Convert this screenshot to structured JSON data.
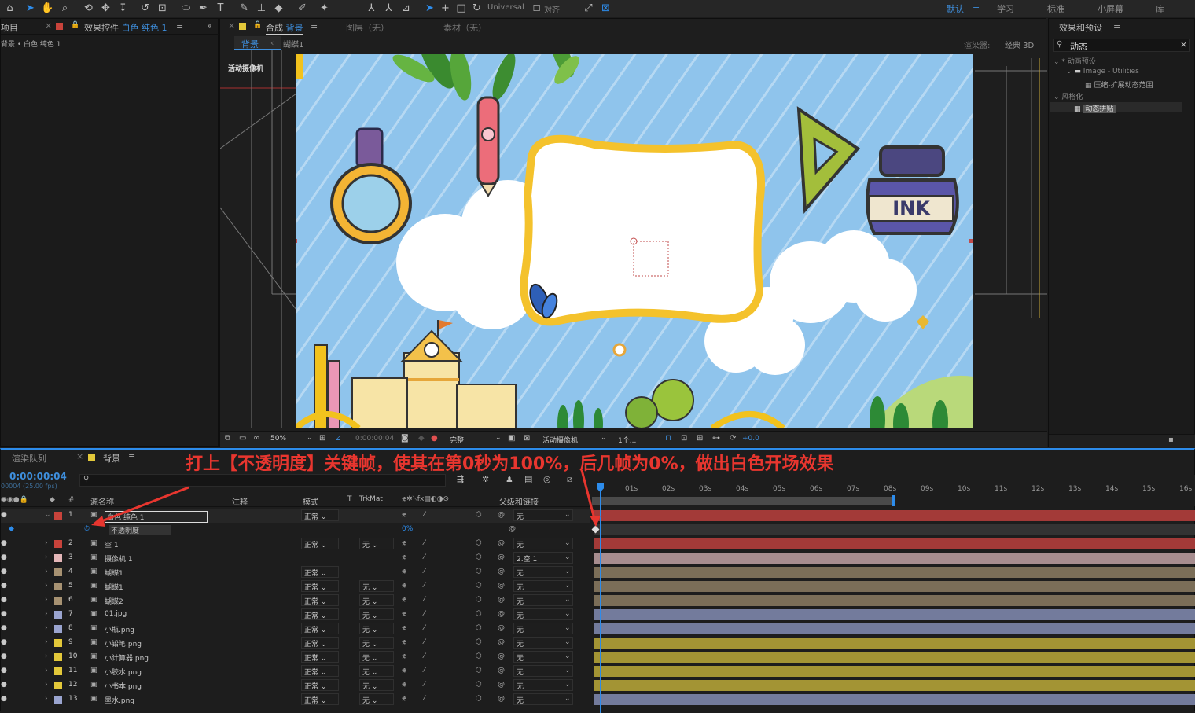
{
  "toolbar": {
    "universal_label": "Universal",
    "align_label": "对齐",
    "workspaces": [
      "默认",
      "学习",
      "标准",
      "小屏幕",
      "库"
    ],
    "active_workspace": "默认"
  },
  "project_panel": {
    "tab_label": "项目",
    "effects_tab_prefix": "效果控件",
    "effects_tab_layer": "白色 纯色 1",
    "breadcrumb": "背景 • 白色 纯色 1"
  },
  "comp_panel": {
    "tab_prefix": "合成",
    "tab_comp": "背景",
    "layer_tab": "图层（无）",
    "footage_tab": "素材（无）",
    "subtab_active": "背景",
    "subtab_next": "蝴蝶1",
    "renderer_label": "渲染器:",
    "renderer_value": "经典 3D",
    "camera_label": "活动摄像机",
    "artboard_text": "INK"
  },
  "viewer_footer": {
    "zoom": "50%",
    "timecode": "0:00:00:04",
    "resolution": "完整",
    "camera_view": "活动摄像机",
    "views": "1个...",
    "exposure": "+0.0"
  },
  "effects_presets": {
    "title": "效果和预设",
    "search_value": "动态",
    "tree": [
      {
        "label": "* 动画预设"
      },
      {
        "label": "Image - Utilities"
      },
      {
        "label": "压缩-扩展动态范围"
      },
      {
        "label": "风格化"
      },
      {
        "label": "动态拼贴"
      }
    ]
  },
  "timeline": {
    "render_queue_tab": "渲染队列",
    "comp_tab": "背景",
    "timecode": "0:00:00:04",
    "fps_label": "00004 (25.00 fps)",
    "search_placeholder": "",
    "headers": {
      "source_name": "源名称",
      "comment": "注释",
      "mode": "模式",
      "t": "T",
      "trkmat": "TrkMat",
      "parent": "父级和链接"
    },
    "opacity_prop": "不透明度",
    "opacity_value": "0%",
    "ruler": [
      "01s",
      "02s",
      "03s",
      "04s",
      "05s",
      "06s",
      "07s",
      "08s",
      "09s",
      "10s",
      "11s",
      "12s",
      "13s",
      "14s",
      "15s",
      "16s"
    ],
    "layers": [
      {
        "num": "1",
        "name": "白色 纯色 1",
        "mode": "正常",
        "trkmat": "",
        "parent": "无",
        "color": "#c8433b",
        "bar": "#a33a38"
      },
      {
        "num": "2",
        "name": "空 1",
        "mode": "正常",
        "trkmat": "无",
        "parent": "无",
        "color": "#c8433b",
        "bar": "#a33a38"
      },
      {
        "num": "3",
        "name": "摄像机 1",
        "mode": "",
        "trkmat": "",
        "parent": "2.空 1",
        "color": "#e5b7b9",
        "bar": "#a78d8f"
      },
      {
        "num": "4",
        "name": "蝴蝶1",
        "mode": "正常",
        "trkmat": "",
        "parent": "无",
        "color": "#a79272",
        "bar": "#7b6e58"
      },
      {
        "num": "5",
        "name": "蝴蝶1",
        "mode": "正常",
        "trkmat": "无",
        "parent": "无",
        "color": "#a79272",
        "bar": "#7b6e58"
      },
      {
        "num": "6",
        "name": "蝴蝶2",
        "mode": "正常",
        "trkmat": "无",
        "parent": "无",
        "color": "#a79272",
        "bar": "#7b6e58"
      },
      {
        "num": "7",
        "name": "01.jpg",
        "mode": "正常",
        "trkmat": "无",
        "parent": "无",
        "color": "#9aa4cf",
        "bar": "#737b9c"
      },
      {
        "num": "8",
        "name": "小瓶.png",
        "mode": "正常",
        "trkmat": "无",
        "parent": "无",
        "color": "#9aa4cf",
        "bar": "#737b9c"
      },
      {
        "num": "9",
        "name": "小铅笔.png",
        "mode": "正常",
        "trkmat": "无",
        "parent": "无",
        "color": "#e3c83a",
        "bar": "#a39434"
      },
      {
        "num": "10",
        "name": "小计算器.png",
        "mode": "正常",
        "trkmat": "无",
        "parent": "无",
        "color": "#e3c83a",
        "bar": "#a39434"
      },
      {
        "num": "11",
        "name": "小胶水.png",
        "mode": "正常",
        "trkmat": "无",
        "parent": "无",
        "color": "#e3c83a",
        "bar": "#a39434"
      },
      {
        "num": "12",
        "name": "小书本.png",
        "mode": "正常",
        "trkmat": "无",
        "parent": "无",
        "color": "#e3c83a",
        "bar": "#a39434"
      },
      {
        "num": "13",
        "name": "墨水.png",
        "mode": "正常",
        "trkmat": "无",
        "parent": "无",
        "color": "#9aa4cf",
        "bar": "#737b9c"
      }
    ]
  },
  "annotation": {
    "text": "打上【不透明度】关键帧，使其在第0秒为100%，后几帧为0%，做出白色开场效果",
    "color": "#e8362f"
  }
}
